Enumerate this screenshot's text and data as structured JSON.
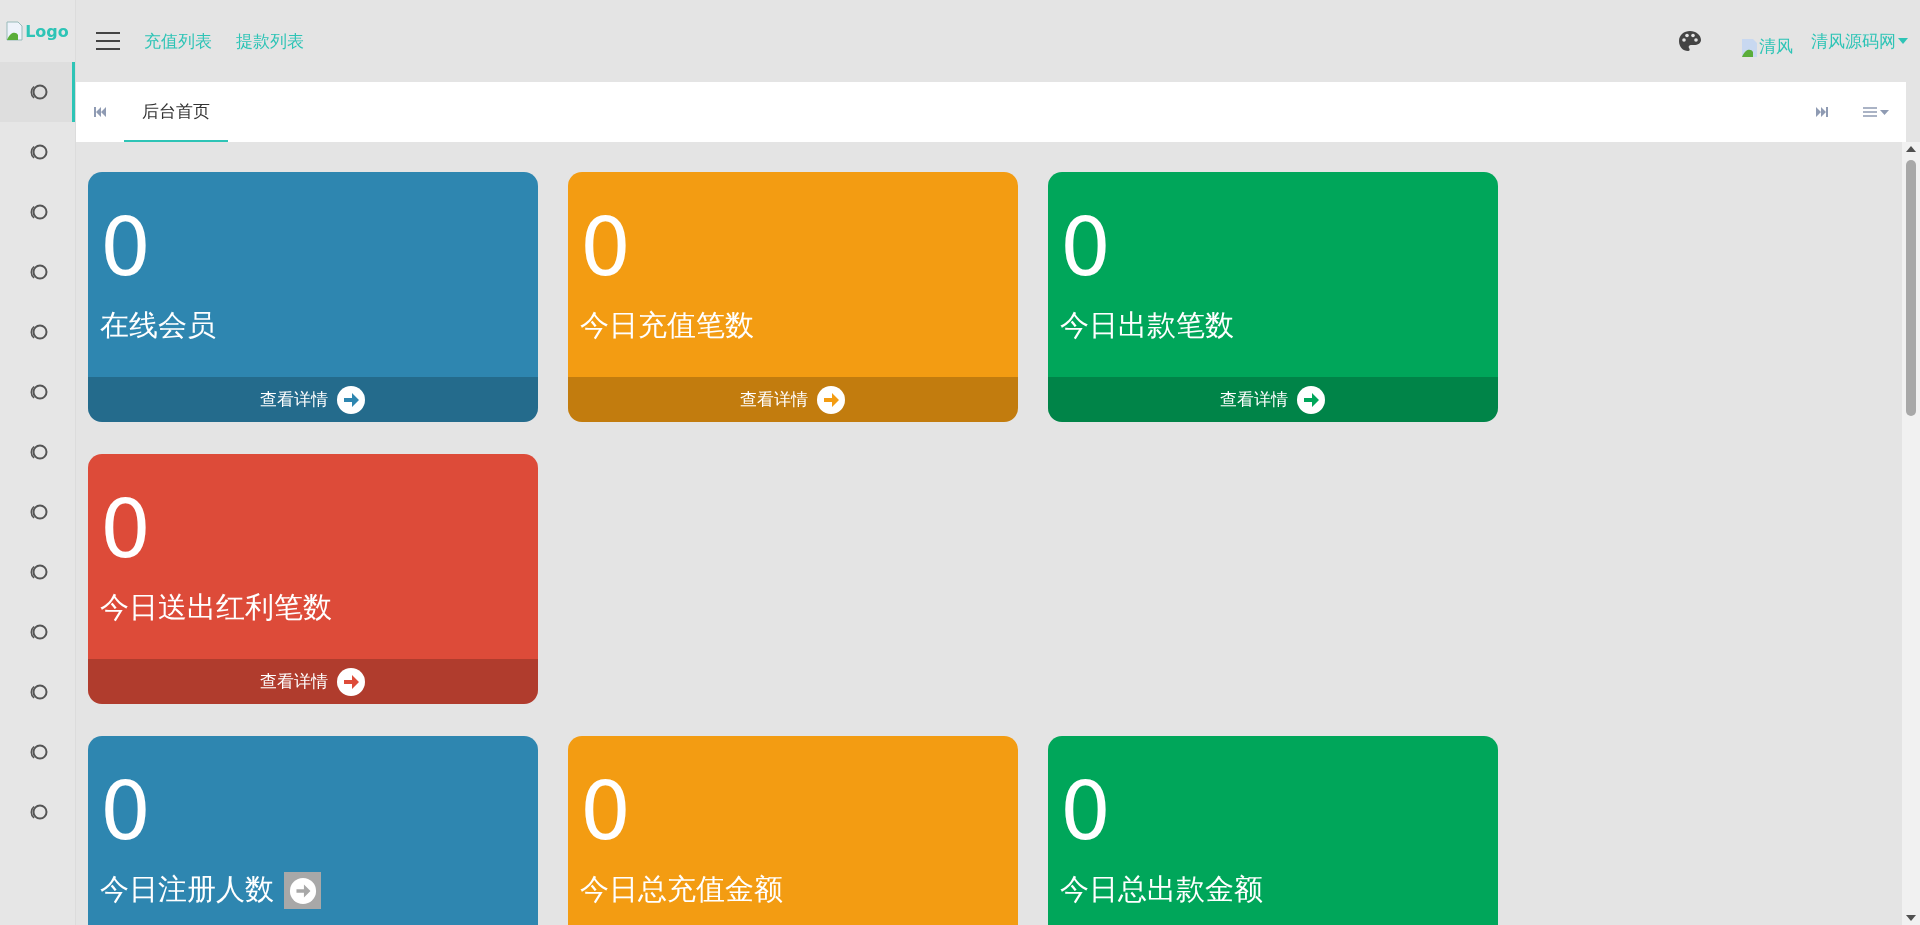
{
  "logo": {
    "alt": "Logo"
  },
  "top_nav": [
    {
      "label": "充值列表"
    },
    {
      "label": "提款列表"
    }
  ],
  "user": {
    "avatar_alt": "清风",
    "name": "清风源码网"
  },
  "sidebar": {
    "items": [
      {
        "selected": true
      },
      {
        "selected": false
      },
      {
        "selected": false
      },
      {
        "selected": false
      },
      {
        "selected": false
      },
      {
        "selected": false
      },
      {
        "selected": false
      },
      {
        "selected": false
      },
      {
        "selected": false
      },
      {
        "selected": false
      },
      {
        "selected": false
      },
      {
        "selected": false
      },
      {
        "selected": false
      }
    ]
  },
  "tabs": [
    {
      "label": "后台首页",
      "selected": true
    }
  ],
  "card_rows": [
    [
      {
        "value": "0",
        "label": "在线会员",
        "color": "#2e86b0",
        "label_icon": false,
        "footer": "查看详情"
      },
      {
        "value": "0",
        "label": "今日充值笔数",
        "color": "#f39c12",
        "label_icon": false,
        "footer": "查看详情"
      },
      {
        "value": "0",
        "label": "今日出款笔数",
        "color": "#00a65a",
        "label_icon": false,
        "footer": "查看详情"
      }
    ],
    [
      {
        "value": "0",
        "label": "今日送出红利笔数",
        "color": "#dd4b39",
        "label_icon": false,
        "footer": "查看详情"
      }
    ],
    [
      {
        "value": "0",
        "label": "今日注册人数",
        "color": "#2e86b0",
        "label_icon": true
      },
      {
        "value": "0",
        "label": "今日总充值金额",
        "color": "#f39c12",
        "label_icon": false
      },
      {
        "value": "0",
        "label": "今日总出款金额",
        "color": "#00a65a",
        "label_icon": false
      }
    ]
  ]
}
